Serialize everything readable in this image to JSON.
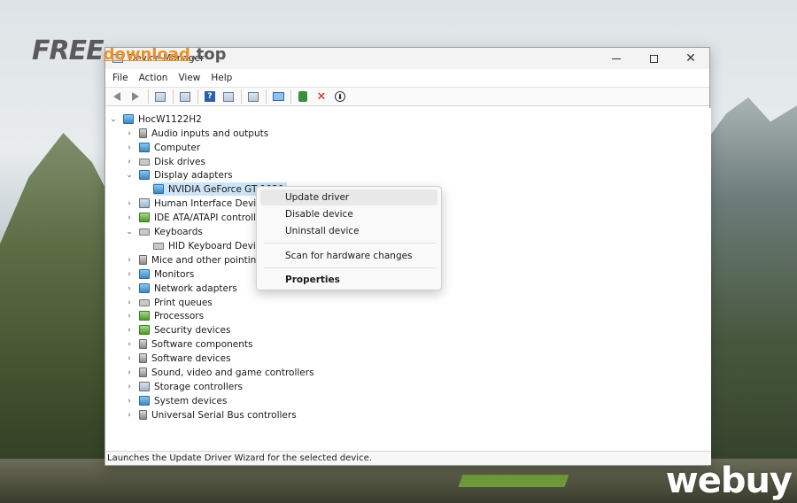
{
  "watermark": {
    "free": "FREE",
    "download": "download",
    "top": ".top",
    "brand": "webuy"
  },
  "window": {
    "title": "Device Manager"
  },
  "menubar": [
    "File",
    "Action",
    "View",
    "Help"
  ],
  "tree": {
    "root": "HocW1122H2",
    "categories": [
      {
        "label": "Audio inputs and outputs",
        "expanded": false,
        "icon": "speaker-icon"
      },
      {
        "label": "Computer",
        "expanded": false,
        "icon": "monitor-icon"
      },
      {
        "label": "Disk drives",
        "expanded": false,
        "icon": "disk-icon"
      },
      {
        "label": "Display adapters",
        "expanded": true,
        "icon": "display-adapter-icon"
      },
      {
        "label": "NVIDIA GeForce GT 1030",
        "child": true,
        "selected": true,
        "icon": "display-adapter-icon"
      },
      {
        "label": "Human Interface Devices",
        "expanded": false,
        "icon": "hid-icon"
      },
      {
        "label": "IDE ATA/ATAPI controllers",
        "expanded": false,
        "icon": "ide-controller-icon"
      },
      {
        "label": "Keyboards",
        "expanded": true,
        "icon": "keyboard-icon"
      },
      {
        "label": "HID Keyboard Device",
        "child": true,
        "icon": "keyboard-icon"
      },
      {
        "label": "Mice and other pointing devices",
        "expanded": false,
        "icon": "mouse-icon"
      },
      {
        "label": "Monitors",
        "expanded": false,
        "icon": "monitor-icon"
      },
      {
        "label": "Network adapters",
        "expanded": false,
        "icon": "network-icon"
      },
      {
        "label": "Print queues",
        "expanded": false,
        "icon": "printer-icon"
      },
      {
        "label": "Processors",
        "expanded": false,
        "icon": "processor-icon"
      },
      {
        "label": "Security devices",
        "expanded": false,
        "icon": "security-icon"
      },
      {
        "label": "Software components",
        "expanded": false,
        "icon": "software-component-icon"
      },
      {
        "label": "Software devices",
        "expanded": false,
        "icon": "software-device-icon"
      },
      {
        "label": "Sound, video and game controllers",
        "expanded": false,
        "icon": "speaker-icon"
      },
      {
        "label": "Storage controllers",
        "expanded": false,
        "icon": "storage-icon"
      },
      {
        "label": "System devices",
        "expanded": false,
        "icon": "system-icon"
      },
      {
        "label": "Universal Serial Bus controllers",
        "expanded": false,
        "icon": "usb-icon"
      }
    ]
  },
  "context_menu": {
    "items": [
      {
        "label": "Update driver",
        "hover": true
      },
      {
        "label": "Disable device"
      },
      {
        "label": "Uninstall device"
      },
      {
        "label": "Scan for hardware changes"
      },
      {
        "label": "Properties",
        "bold": true
      }
    ]
  },
  "status": "Launches the Update Driver Wizard for the selected device.",
  "colors": {
    "selection": "#cce4f7",
    "accent": "#2d5fa8",
    "delete": "#d11f1f"
  }
}
